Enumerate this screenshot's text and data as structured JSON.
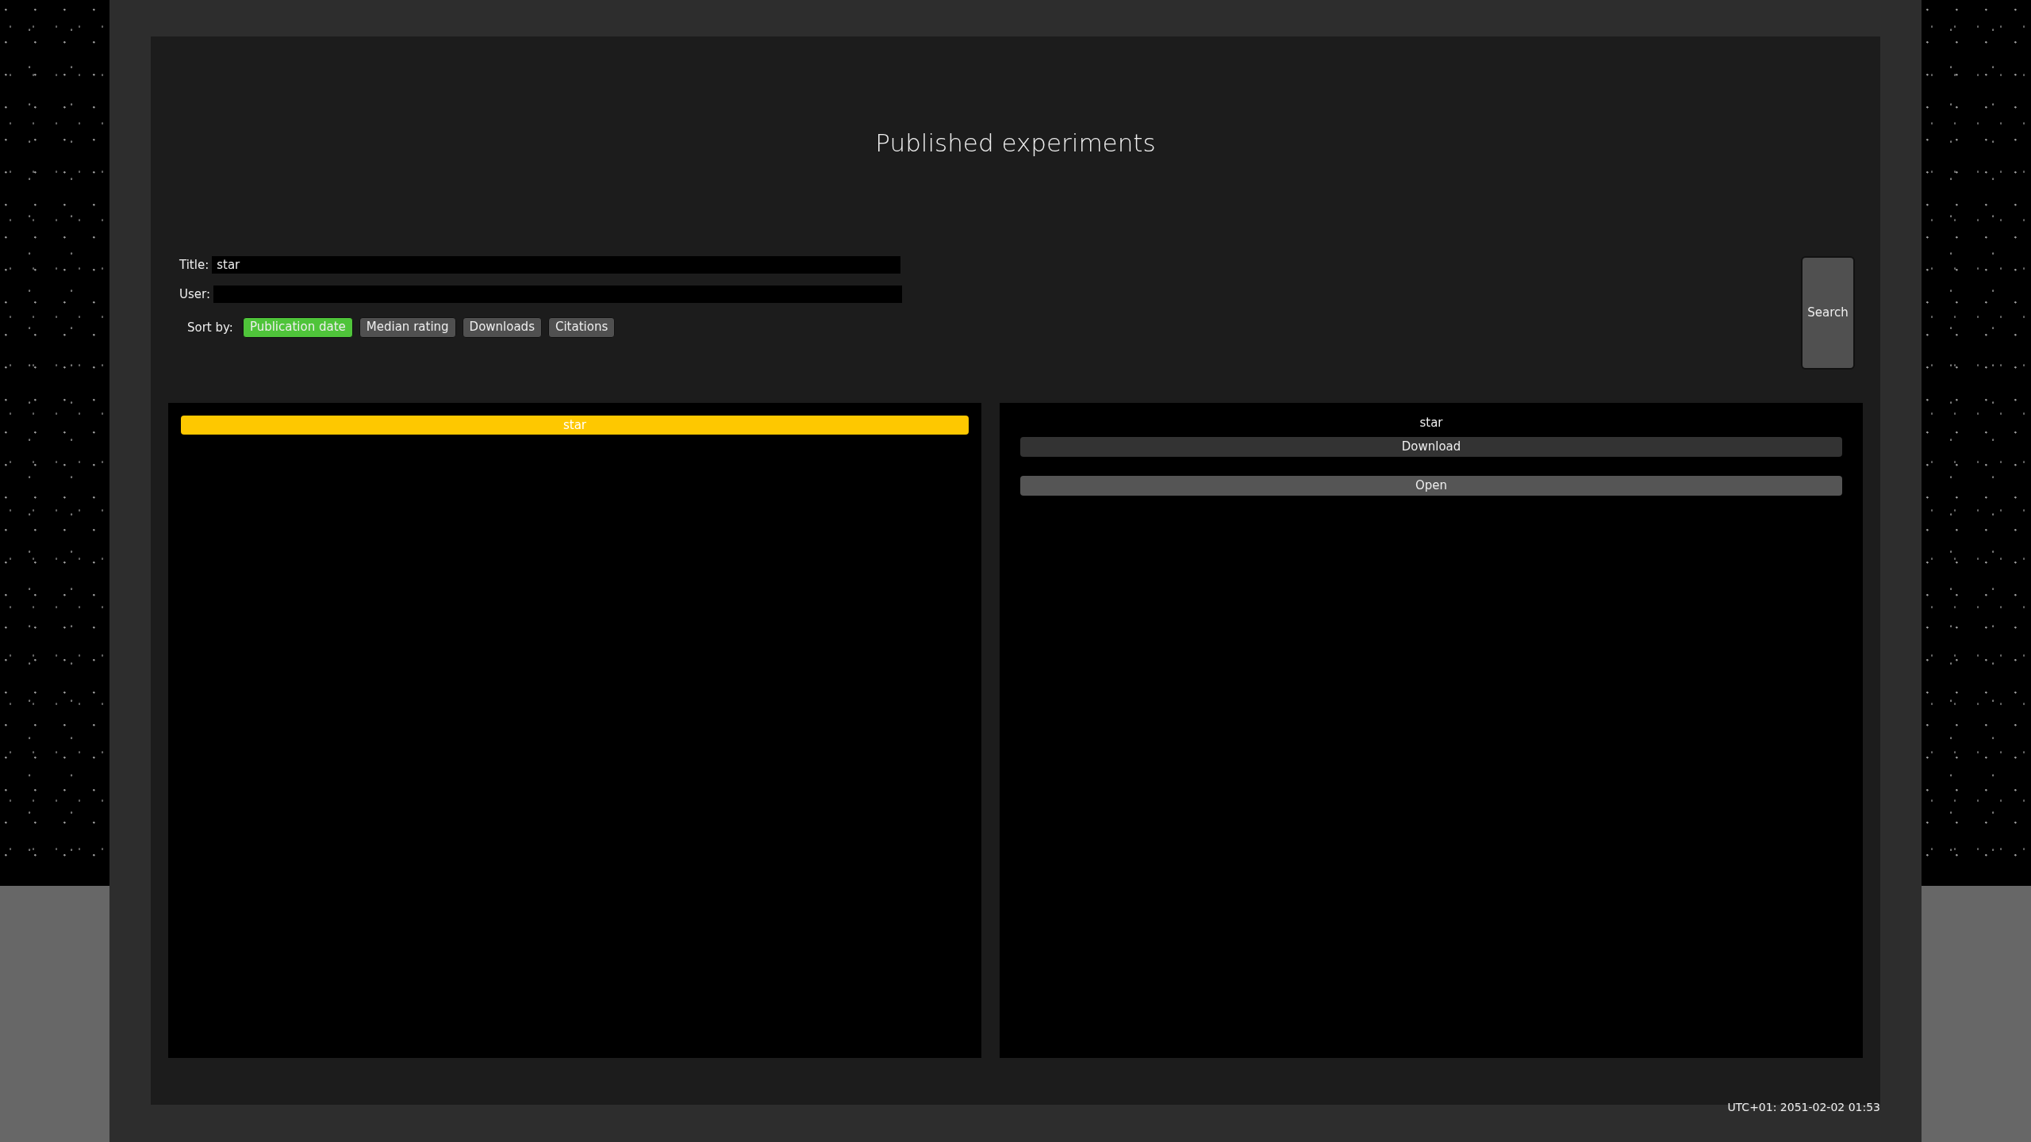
{
  "title": "Published experiments",
  "filters": [
    {
      "label": "Title:",
      "value": "star"
    },
    {
      "label": "User:"
    }
  ],
  "sort": {
    "label": "Sort by:",
    "options": [
      {
        "label": "Publication date",
        "selected": true
      },
      {
        "label": "Median rating",
        "selected": false
      },
      {
        "label": "Downloads",
        "selected": false
      },
      {
        "label": "Citations",
        "selected": false
      }
    ]
  },
  "search_button": "Search",
  "results": [
    {
      "title": "star",
      "selected": true
    }
  ],
  "detail": {
    "title": "star",
    "buttons": [
      {
        "label": "Download",
        "highlighted": false
      },
      {
        "label": "Open",
        "highlighted": true
      }
    ]
  },
  "timestamp": "UTC+01: 2051-02-02 01:53"
}
